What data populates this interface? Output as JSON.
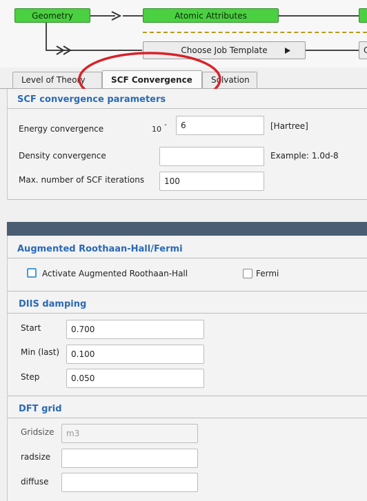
{
  "workflow": {
    "geometry": "Geometry",
    "atomic_attributes": "Atomic Attributes",
    "choose_job_template": "Choose Job Template",
    "cut_label": "C"
  },
  "tabs": [
    {
      "label": "Level of Theory",
      "active": false
    },
    {
      "label": "SCF Convergence",
      "active": true
    },
    {
      "label": "Solvation",
      "active": false
    }
  ],
  "scf": {
    "title": "SCF convergence parameters",
    "energy_label": "Energy convergence",
    "energy_prefix": "10",
    "energy_exponent_sign": "-",
    "energy_value": "6",
    "energy_unit": "[Hartree]",
    "density_label": "Density convergence",
    "density_value": "",
    "density_example": "Example: 1.0d-8",
    "iterations_label": "Max. number of SCF iterations",
    "iterations_value": "100"
  },
  "augmented": {
    "title": "Augmented Roothaan-Hall/Fermi",
    "activate_label": "Activate Augmented Roothaan-Hall",
    "fermi_label": "Fermi"
  },
  "diis": {
    "title": "DIIS damping",
    "start_label": "Start",
    "start_value": "0.700",
    "min_label": "Min (last)",
    "min_value": "0.100",
    "step_label": "Step",
    "step_value": "0.050"
  },
  "dft": {
    "title": "DFT grid",
    "gridsize_label": "Gridsize",
    "gridsize_placeholder": "m3",
    "radsize_label": "radsize",
    "radsize_value": "",
    "diffuse_label": "diffuse",
    "diffuse_value": ""
  },
  "annotation_color": "#d8232a",
  "accent_color": "#2a6ab5"
}
